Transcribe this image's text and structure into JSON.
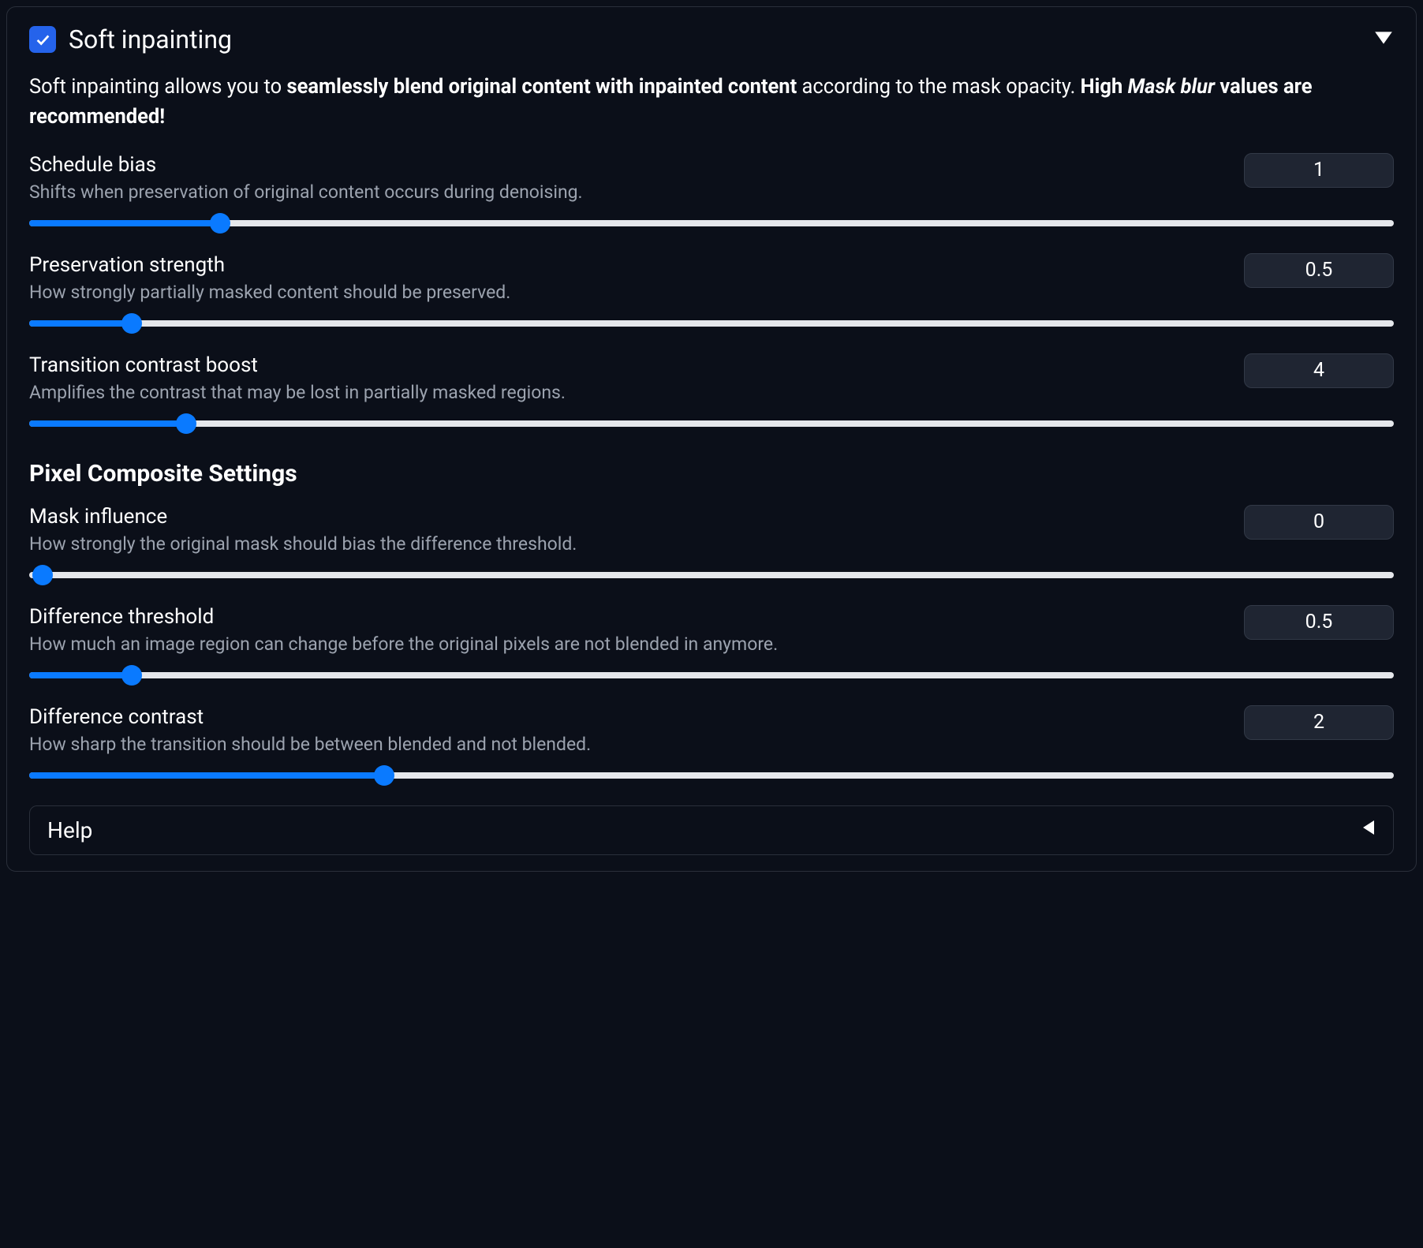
{
  "header": {
    "title": "Soft inpainting",
    "checked": true
  },
  "description": {
    "prefix": "Soft inpainting allows you to ",
    "bold1": "seamlessly blend original content with inpainted content",
    "mid": " according to the mask opacity. ",
    "hi_prefix": "High ",
    "hi_italic": "Mask blur",
    "hi_suffix": " values are recommended!"
  },
  "params": {
    "schedule_bias": {
      "label": "Schedule bias",
      "desc": "Shifts when preservation of original content occurs during denoising.",
      "value": "1",
      "fill_pct": 14
    },
    "preservation_strength": {
      "label": "Preservation strength",
      "desc": "How strongly partially masked content should be preserved.",
      "value": "0.5",
      "fill_pct": 7.5
    },
    "transition_contrast_boost": {
      "label": "Transition contrast boost",
      "desc": "Amplifies the contrast that may be lost in partially masked regions.",
      "value": "4",
      "fill_pct": 11.5
    },
    "mask_influence": {
      "label": "Mask influence",
      "desc": "How strongly the original mask should bias the difference threshold.",
      "value": "0",
      "fill_pct": 0
    },
    "difference_threshold": {
      "label": "Difference threshold",
      "desc": "How much an image region can change before the original pixels are not blended in anymore.",
      "value": "0.5",
      "fill_pct": 7.5
    },
    "difference_contrast": {
      "label": "Difference contrast",
      "desc": "How sharp the transition should be between blended and not blended.",
      "value": "2",
      "fill_pct": 26
    }
  },
  "section_heading": "Pixel Composite Settings",
  "help_label": "Help"
}
